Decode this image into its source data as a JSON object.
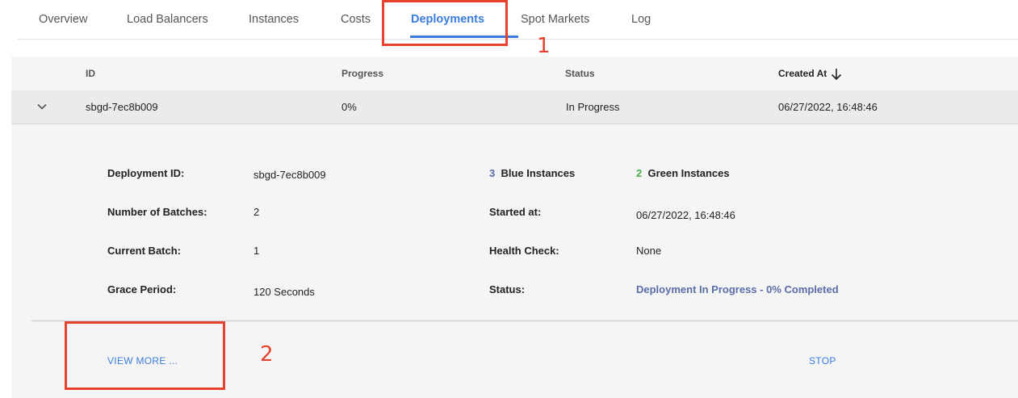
{
  "tabs": [
    {
      "label": "Overview",
      "active": false
    },
    {
      "label": "Load Balancers",
      "active": false
    },
    {
      "label": "Instances",
      "active": false
    },
    {
      "label": "Costs",
      "active": false
    },
    {
      "label": "Deployments",
      "active": true
    },
    {
      "label": "Spot Markets",
      "active": false
    },
    {
      "label": "Log",
      "active": false
    }
  ],
  "annotations": {
    "one": "1",
    "two": "2"
  },
  "table": {
    "headers": {
      "id": "ID",
      "progress": "Progress",
      "status": "Status",
      "created_at": "Created At"
    },
    "sort": {
      "column": "Created At",
      "direction": "desc",
      "icon": "arrow-down-icon"
    },
    "rows": [
      {
        "id": "sbgd-7ec8b009",
        "progress": "0%",
        "status": "In Progress",
        "created_at": "06/27/2022, 16:48:46",
        "expanded": true
      }
    ]
  },
  "detail": {
    "deployment_id": {
      "label": "Deployment ID:",
      "value": "sbgd-7ec8b009"
    },
    "batches": {
      "label": "Number of Batches:",
      "value": "2"
    },
    "current_batch": {
      "label": "Current Batch:",
      "value": "1"
    },
    "grace_period": {
      "label": "Grace Period:",
      "value": "120 Seconds"
    },
    "blue": {
      "count": "3",
      "label": "Blue Instances"
    },
    "green": {
      "count": "2",
      "label": "Green Instances"
    },
    "started_at": {
      "label": "Started at:",
      "value": "06/27/2022, 16:48:46"
    },
    "health_check": {
      "label": "Health Check:",
      "value": "None"
    },
    "status": {
      "label": "Status:",
      "value": "Deployment In Progress - 0% Completed"
    }
  },
  "actions": {
    "view_more": "VIEW MORE ...",
    "stop": "STOP"
  },
  "colors": {
    "accent": "#3b7ddd",
    "annotation": "#e8422f",
    "blue_count": "#5a6da8",
    "green_count": "#4caf50"
  }
}
